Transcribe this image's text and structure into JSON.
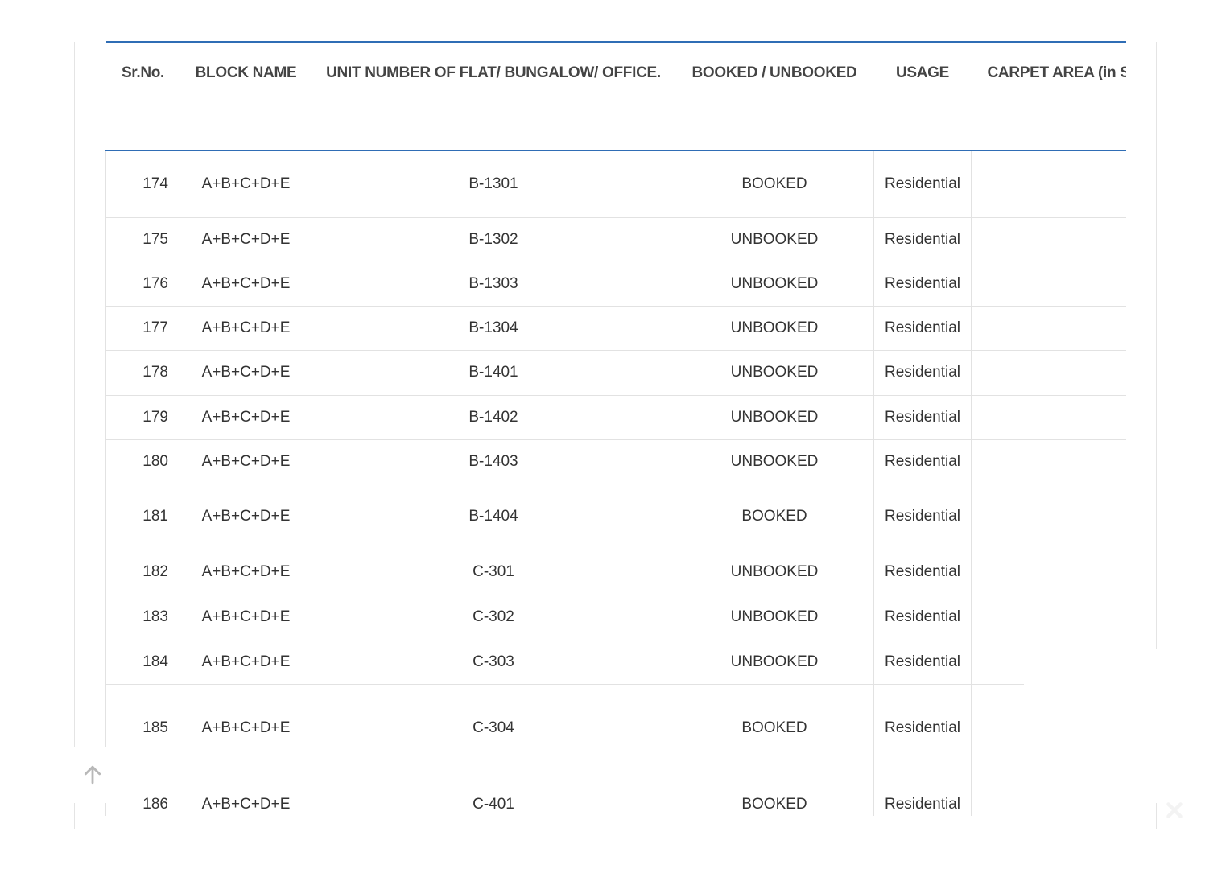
{
  "table": {
    "headers": [
      "Sr.No.",
      "BLOCK NAME",
      "UNIT NUMBER OF FLAT/ BUNGALOW/ OFFICE.",
      "BOOKED / UNBOOKED",
      "USAGE",
      "CARPET AREA (in Sq"
    ],
    "rows": [
      {
        "sr": "174",
        "block": "A+B+C+D+E",
        "unit": "B-1301",
        "status": "BOOKED",
        "usage": "Residential",
        "carpet": ""
      },
      {
        "sr": "175",
        "block": "A+B+C+D+E",
        "unit": "B-1302",
        "status": "UNBOOKED",
        "usage": "Residential",
        "carpet": ""
      },
      {
        "sr": "176",
        "block": "A+B+C+D+E",
        "unit": "B-1303",
        "status": "UNBOOKED",
        "usage": "Residential",
        "carpet": ""
      },
      {
        "sr": "177",
        "block": "A+B+C+D+E",
        "unit": "B-1304",
        "status": "UNBOOKED",
        "usage": "Residential",
        "carpet": ""
      },
      {
        "sr": "178",
        "block": "A+B+C+D+E",
        "unit": "B-1401",
        "status": "UNBOOKED",
        "usage": "Residential",
        "carpet": ""
      },
      {
        "sr": "179",
        "block": "A+B+C+D+E",
        "unit": "B-1402",
        "status": "UNBOOKED",
        "usage": "Residential",
        "carpet": ""
      },
      {
        "sr": "180",
        "block": "A+B+C+D+E",
        "unit": "B-1403",
        "status": "UNBOOKED",
        "usage": "Residential",
        "carpet": ""
      },
      {
        "sr": "181",
        "block": "A+B+C+D+E",
        "unit": "B-1404",
        "status": "BOOKED",
        "usage": "Residential",
        "carpet": ""
      },
      {
        "sr": "182",
        "block": "A+B+C+D+E",
        "unit": "C-301",
        "status": "UNBOOKED",
        "usage": "Residential",
        "carpet": ""
      },
      {
        "sr": "183",
        "block": "A+B+C+D+E",
        "unit": "C-302",
        "status": "UNBOOKED",
        "usage": "Residential",
        "carpet": ""
      },
      {
        "sr": "184",
        "block": "A+B+C+D+E",
        "unit": "C-303",
        "status": "UNBOOKED",
        "usage": "Residential",
        "carpet": ""
      },
      {
        "sr": "185",
        "block": "A+B+C+D+E",
        "unit": "C-304",
        "status": "BOOKED",
        "usage": "Residential",
        "carpet": ""
      },
      {
        "sr": "186",
        "block": "A+B+C+D+E",
        "unit": "C-401",
        "status": "BOOKED",
        "usage": "Residential",
        "carpet": ""
      }
    ]
  },
  "controls": {
    "scroll_top_icon": "arrow-up-icon",
    "close_icon": "close-icon"
  },
  "colors": {
    "header_rule": "#2f6db5",
    "cell_border": "#e2e2e2",
    "text": "#333333"
  }
}
